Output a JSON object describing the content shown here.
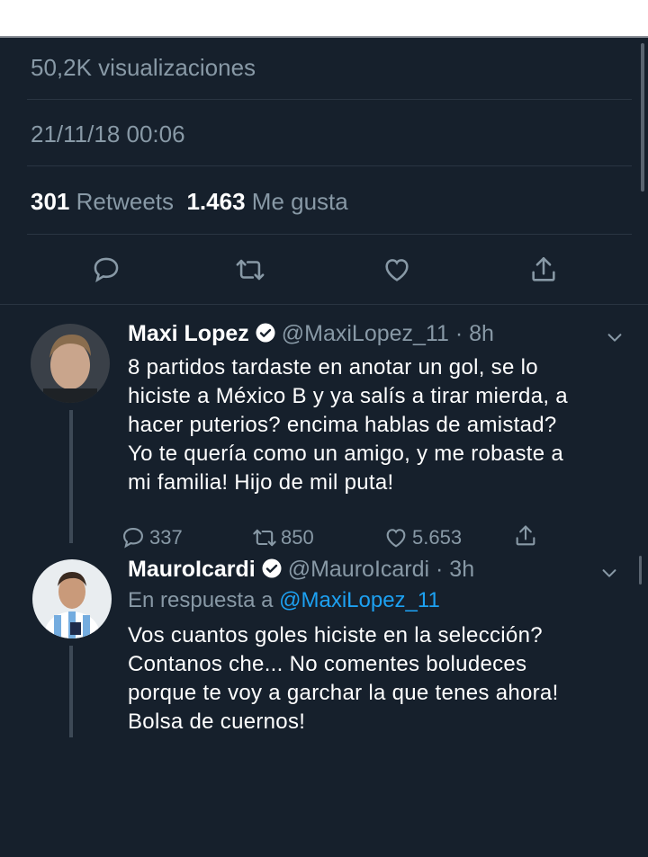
{
  "detail": {
    "views": "50,2K visualizaciones",
    "timestamp": "21/11/18 00:06",
    "retweets_count": "301",
    "retweets_label": "Retweets",
    "likes_count": "1.463",
    "likes_label": "Me gusta"
  },
  "tweets": [
    {
      "name": "Maxi Lopez",
      "handle": "@MaxiLopez_11 · 8h",
      "lines": [
        "8 partidos tardaste en anotar un gol, se lo",
        "hiciste a México B y ya salís a tirar mierda, a",
        "hacer puterios? encima hablas de amistad?",
        "Yo te quería como un amigo, y me robaste a",
        "mi familia! Hijo de mil puta!"
      ],
      "replies": "337",
      "retweets": "850",
      "likes": "5.653"
    },
    {
      "name": "MauroIcardi",
      "handle": "@MauroIcardi · 3h",
      "reply_prefix": "En respuesta a",
      "reply_to": "@MaxiLopez_11",
      "lines": [
        "Vos cuantos goles hiciste en la selección?",
        "Contanos che... No comentes boludeces",
        "porque te voy a garchar la que tenes ahora!",
        "Bolsa de cuernos!"
      ]
    }
  ],
  "colors": {
    "background": "#16202c",
    "secondary_text": "#8899a6",
    "link": "#1da1f2",
    "verified": "#ffffff"
  },
  "icons": [
    "reply-icon",
    "retweet-icon",
    "like-icon",
    "share-icon",
    "verified-icon",
    "chevron-down-icon"
  ]
}
